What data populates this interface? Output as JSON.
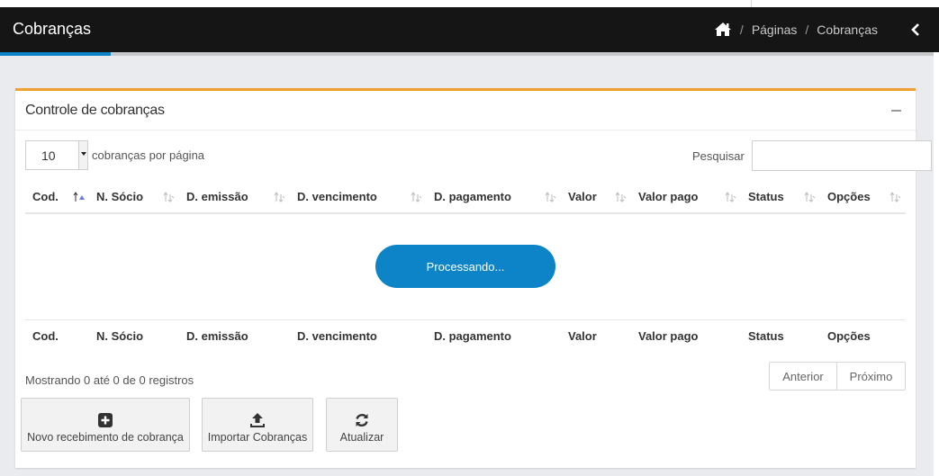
{
  "header": {
    "title": "Cobranças",
    "breadcrumb": [
      "Páginas",
      "Cobranças"
    ],
    "accent_color": "#0d83c8"
  },
  "panel": {
    "title": "Controle de cobranças",
    "accent_color": "#f0a030"
  },
  "length": {
    "value": "10",
    "label": "cobranças por página"
  },
  "search": {
    "label": "Pesquisar",
    "value": "",
    "placeholder": ""
  },
  "table": {
    "columns": [
      "Cod.",
      "N. Sócio",
      "D. emissão",
      "D. vencimento",
      "D. pagamento",
      "Valor",
      "Valor pago",
      "Status",
      "Opções"
    ],
    "sorted_column": "Cod.",
    "rows": []
  },
  "processing_text": "Processando...",
  "info": "Mostrando 0 até 0 de 0 registros",
  "pagination": {
    "previous": "Anterior",
    "next": "Próximo"
  },
  "actions": [
    {
      "label": "Novo recebimento de cobrança",
      "icon": "plus-square-icon"
    },
    {
      "label": "Importar Cobranças",
      "icon": "upload-icon"
    },
    {
      "label": "Atualizar",
      "icon": "refresh-icon"
    }
  ]
}
